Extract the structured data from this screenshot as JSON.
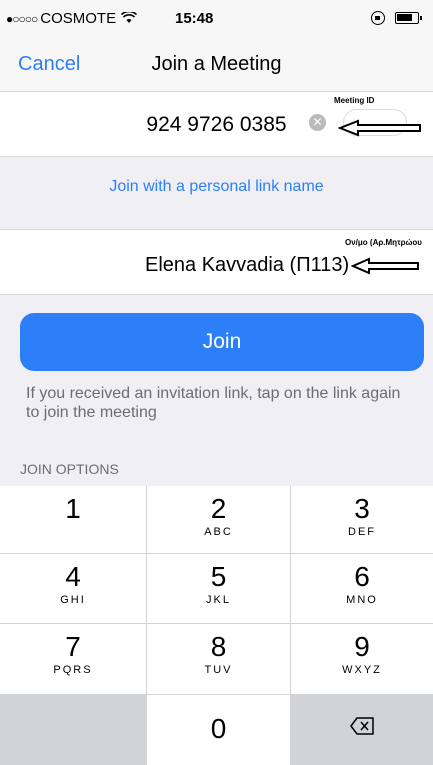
{
  "status_bar": {
    "signal": "●○○○○",
    "carrier": "COSMOTE",
    "wifi_icon": "wifi-icon",
    "time": "15:48"
  },
  "nav": {
    "cancel_label": "Cancel",
    "title": "Join a Meeting"
  },
  "meeting": {
    "meeting_id_value": "924 9726 0385",
    "meeting_id_annotation": "Meeting ID",
    "personal_link_label": "Join with a personal link name",
    "name_value": "Elena Kavvadia (Π113)",
    "name_annotation": "Ον/μο (Αρ.Μητρώου"
  },
  "join": {
    "button_label": "Join",
    "info_text": "If you received an invitation link, tap on the link again to join the meeting",
    "options_header": "JOIN OPTIONS"
  },
  "keypad": {
    "keys": [
      {
        "digit": "1",
        "letters": ""
      },
      {
        "digit": "2",
        "letters": "ABC"
      },
      {
        "digit": "3",
        "letters": "DEF"
      },
      {
        "digit": "4",
        "letters": "GHI"
      },
      {
        "digit": "5",
        "letters": "JKL"
      },
      {
        "digit": "6",
        "letters": "MNO"
      },
      {
        "digit": "7",
        "letters": "PQRS"
      },
      {
        "digit": "8",
        "letters": "TUV"
      },
      {
        "digit": "9",
        "letters": "WXYZ"
      },
      {
        "digit": "0",
        "letters": ""
      }
    ]
  },
  "colors": {
    "accent": "#2d7ff9",
    "keypad_bg": "#d1d3d9"
  }
}
